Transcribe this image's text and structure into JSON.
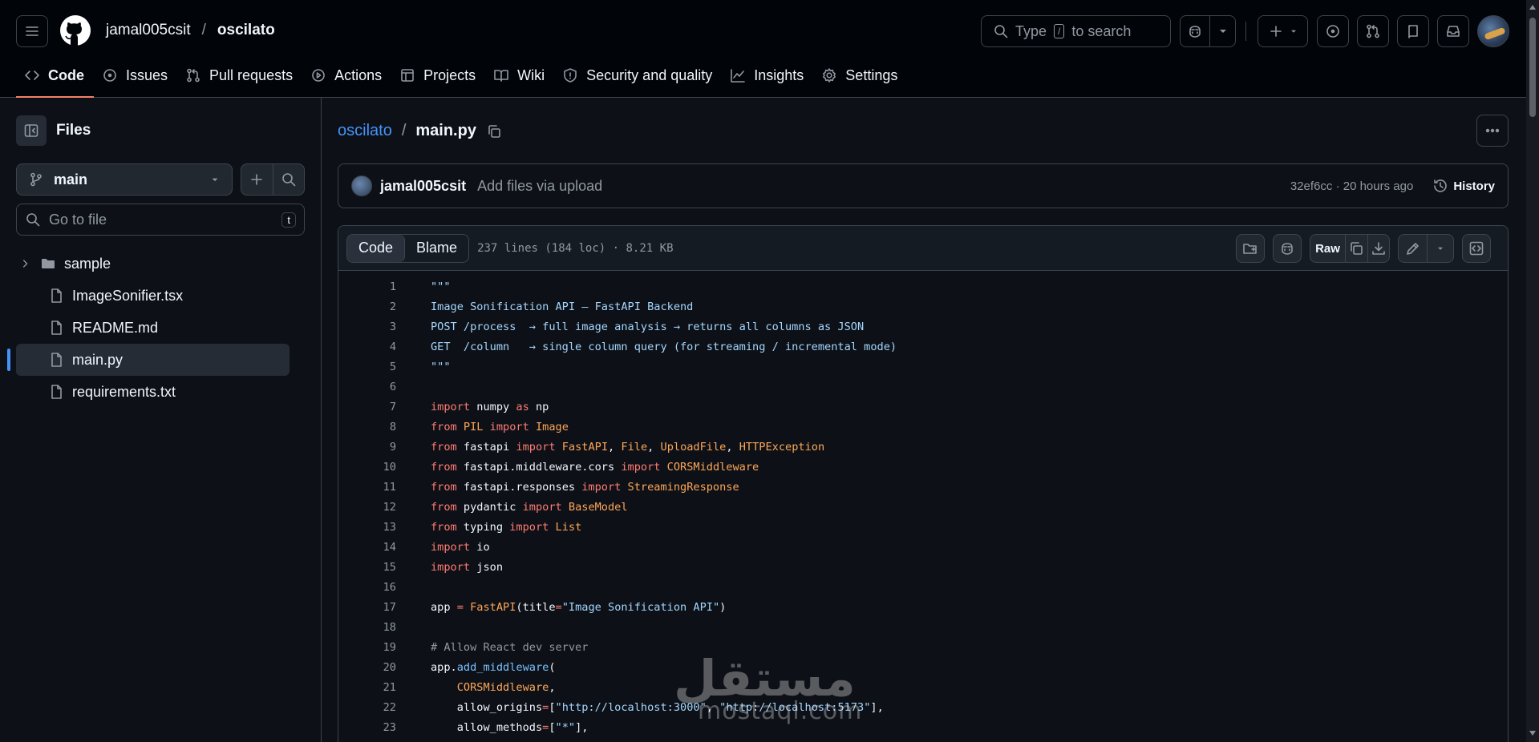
{
  "header": {
    "owner": "jamal005csit",
    "separator": "/",
    "repo": "oscilato",
    "search": {
      "before": "Type",
      "key": "/",
      "after": "to search"
    }
  },
  "nav": [
    {
      "label": "Code",
      "icon": "code-icon",
      "active": true
    },
    {
      "label": "Issues",
      "icon": "issue-opened-icon"
    },
    {
      "label": "Pull requests",
      "icon": "git-pull-request-icon"
    },
    {
      "label": "Actions",
      "icon": "play-icon"
    },
    {
      "label": "Projects",
      "icon": "table-icon"
    },
    {
      "label": "Wiki",
      "icon": "book-icon"
    },
    {
      "label": "Security and quality",
      "icon": "shield-icon"
    },
    {
      "label": "Insights",
      "icon": "graph-icon"
    },
    {
      "label": "Settings",
      "icon": "gear-icon"
    }
  ],
  "sidebar": {
    "title": "Files",
    "branch": "main",
    "goto_placeholder": "Go to file",
    "goto_shortcut": "t",
    "tree": [
      {
        "name": "sample",
        "type": "folder"
      },
      {
        "name": "ImageSonifier.tsx",
        "type": "file"
      },
      {
        "name": "README.md",
        "type": "file"
      },
      {
        "name": "main.py",
        "type": "file",
        "active": true
      },
      {
        "name": "requirements.txt",
        "type": "file"
      }
    ]
  },
  "file": {
    "repo_link": "oscilato",
    "separator": "/",
    "name": "main.py"
  },
  "commit": {
    "author": "jamal005csit",
    "message": "Add files via upload",
    "meta": "32ef6cc · 20 hours ago",
    "history_label": "History"
  },
  "viewer": {
    "tab_code": "Code",
    "tab_blame": "Blame",
    "file_meta": "237 lines (184 loc) · 8.21 KB",
    "raw_label": "Raw"
  },
  "code_lines": [
    [
      [
        "str",
        "\"\"\""
      ]
    ],
    [
      [
        "str",
        "Image Sonification API — FastAPI Backend"
      ]
    ],
    [
      [
        "str",
        "POST /process  → full image analysis → returns all columns as JSON"
      ]
    ],
    [
      [
        "str",
        "GET  /column   → single column query (for streaming / incremental mode)"
      ]
    ],
    [
      [
        "str",
        "\"\"\""
      ]
    ],
    [],
    [
      [
        "kw",
        "import"
      ],
      [
        "",
        " numpy "
      ],
      [
        "kw",
        "as"
      ],
      [
        "",
        " np"
      ]
    ],
    [
      [
        "kw",
        "from"
      ],
      [
        "cls",
        " PIL"
      ],
      [
        "kw",
        " import"
      ],
      [
        "cls",
        " Image"
      ]
    ],
    [
      [
        "kw",
        "from"
      ],
      [
        "",
        " fastapi "
      ],
      [
        "kw",
        "import"
      ],
      [
        "cls",
        " FastAPI"
      ],
      [
        "",
        ", "
      ],
      [
        "cls",
        "File"
      ],
      [
        "",
        ", "
      ],
      [
        "cls",
        "UploadFile"
      ],
      [
        "",
        ", "
      ],
      [
        "cls",
        "HTTPException"
      ]
    ],
    [
      [
        "kw",
        "from"
      ],
      [
        "",
        " fastapi.middleware.cors "
      ],
      [
        "kw",
        "import"
      ],
      [
        "cls",
        " CORSMiddleware"
      ]
    ],
    [
      [
        "kw",
        "from"
      ],
      [
        "",
        " fastapi.responses "
      ],
      [
        "kw",
        "import"
      ],
      [
        "cls",
        " StreamingResponse"
      ]
    ],
    [
      [
        "kw",
        "from"
      ],
      [
        "",
        " pydantic "
      ],
      [
        "kw",
        "import"
      ],
      [
        "cls",
        " BaseModel"
      ]
    ],
    [
      [
        "kw",
        "from"
      ],
      [
        "",
        " typing "
      ],
      [
        "kw",
        "import"
      ],
      [
        "cls",
        " List"
      ]
    ],
    [
      [
        "kw",
        "import"
      ],
      [
        "",
        " io"
      ]
    ],
    [
      [
        "kw",
        "import"
      ],
      [
        "",
        " json"
      ]
    ],
    [],
    [
      [
        "",
        "app "
      ],
      [
        "op",
        "="
      ],
      [
        "cls",
        " FastAPI"
      ],
      [
        "",
        "(title"
      ],
      [
        "op",
        "="
      ],
      [
        "str",
        "\"Image Sonification API\""
      ],
      [
        "",
        ")"
      ]
    ],
    [],
    [
      [
        "com",
        "# Allow React dev server"
      ]
    ],
    [
      [
        "",
        "app."
      ],
      [
        "con",
        "add_middleware"
      ],
      [
        "",
        "("
      ]
    ],
    [
      [
        "cls",
        "    CORSMiddleware"
      ],
      [
        "",
        ","
      ]
    ],
    [
      [
        "",
        "    allow_origins"
      ],
      [
        "op",
        "="
      ],
      [
        "",
        "["
      ],
      [
        "str",
        "\"http://localhost:3000\""
      ],
      [
        "",
        ", "
      ],
      [
        "str",
        "\"http://localhost:5173\""
      ],
      [
        "",
        "],"
      ]
    ],
    [
      [
        "",
        "    allow_methods"
      ],
      [
        "op",
        "="
      ],
      [
        "",
        "["
      ],
      [
        "str",
        "\"*\""
      ],
      [
        "",
        "],"
      ]
    ]
  ],
  "watermark": {
    "arabic": "مستقل",
    "latin": "mostaql.com"
  },
  "colors": {
    "accent_underline": "#f78166",
    "link": "#4493f8",
    "background": "#0d1117",
    "header_background": "#010409"
  }
}
